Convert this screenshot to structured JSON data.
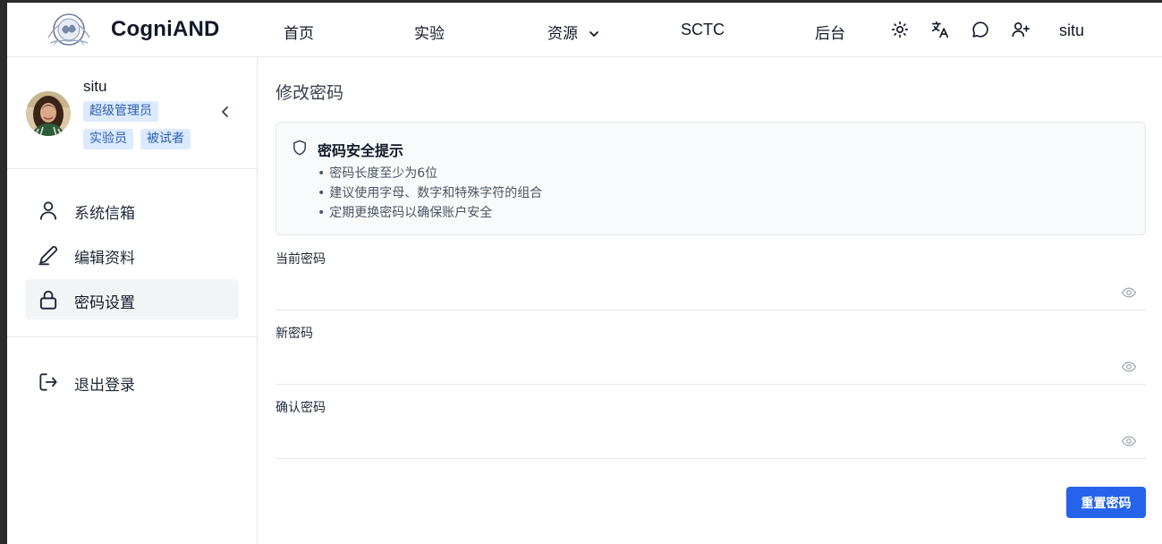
{
  "header": {
    "brand": "CogniAND",
    "nav": {
      "home": "首页",
      "experiment": "实验",
      "resources": "资源",
      "sctc": "SCTC",
      "admin": "后台"
    },
    "icons": {
      "theme": "sun-icon",
      "language": "translate-icon",
      "messages": "chat-bubble-icon",
      "add_user": "user-plus-icon"
    },
    "user": "situ"
  },
  "sidebar": {
    "profile": {
      "name": "situ",
      "badges": [
        "超级管理员",
        "实验员",
        "被试者"
      ]
    },
    "menu": [
      {
        "label": "系统信箱",
        "icon": "user-icon",
        "active": false
      },
      {
        "label": "编辑资料",
        "icon": "pencil-icon",
        "active": false
      },
      {
        "label": "密码设置",
        "icon": "lock-icon",
        "active": true
      }
    ],
    "logout": {
      "label": "退出登录",
      "icon": "logout-icon"
    }
  },
  "main": {
    "title": "修改密码",
    "tips": {
      "title": "密码安全提示",
      "items": [
        "密码长度至少为6位",
        "建议使用字母、数字和特殊字符的组合",
        "定期更换密码以确保账户安全"
      ]
    },
    "fields": {
      "current": {
        "label": "当前密码",
        "value": ""
      },
      "new": {
        "label": "新密码",
        "value": ""
      },
      "confirm": {
        "label": "确认密码",
        "value": ""
      }
    },
    "submit_label": "重置密码"
  },
  "colors": {
    "accent": "#2563eb",
    "badge_bg": "#dbeafe",
    "badge_text": "#2b5fb3",
    "active_menu_bg": "#f3f4f6",
    "border": "#e5e7eb"
  }
}
